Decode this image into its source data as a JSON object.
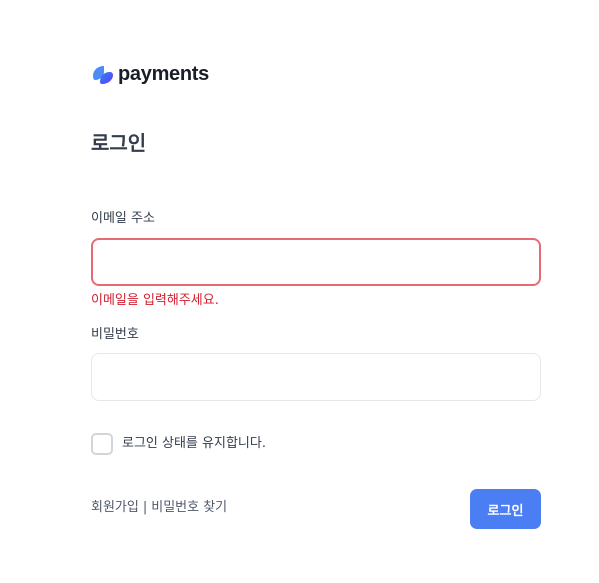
{
  "brand": {
    "name": "payments",
    "logo_icon": "payments-logo-mark",
    "logo_colors": [
      "#3182f6",
      "#5b3ef5"
    ]
  },
  "page": {
    "title": "로그인"
  },
  "form": {
    "email": {
      "label": "이메일 주소",
      "value": "",
      "placeholder": "",
      "error": "이메일을 입력해주세요.",
      "error_color": "#d22030",
      "border_color": "#e56b73"
    },
    "password": {
      "label": "비밀번호",
      "value": "",
      "placeholder": ""
    },
    "remember": {
      "label": "로그인 상태를 유지합니다.",
      "checked": false
    }
  },
  "footer": {
    "signup_label": "회원가입",
    "separator": "|",
    "find_password_label": "비밀번호 찾기"
  },
  "actions": {
    "login_label": "로그인",
    "login_color": "#4c7ef3"
  }
}
